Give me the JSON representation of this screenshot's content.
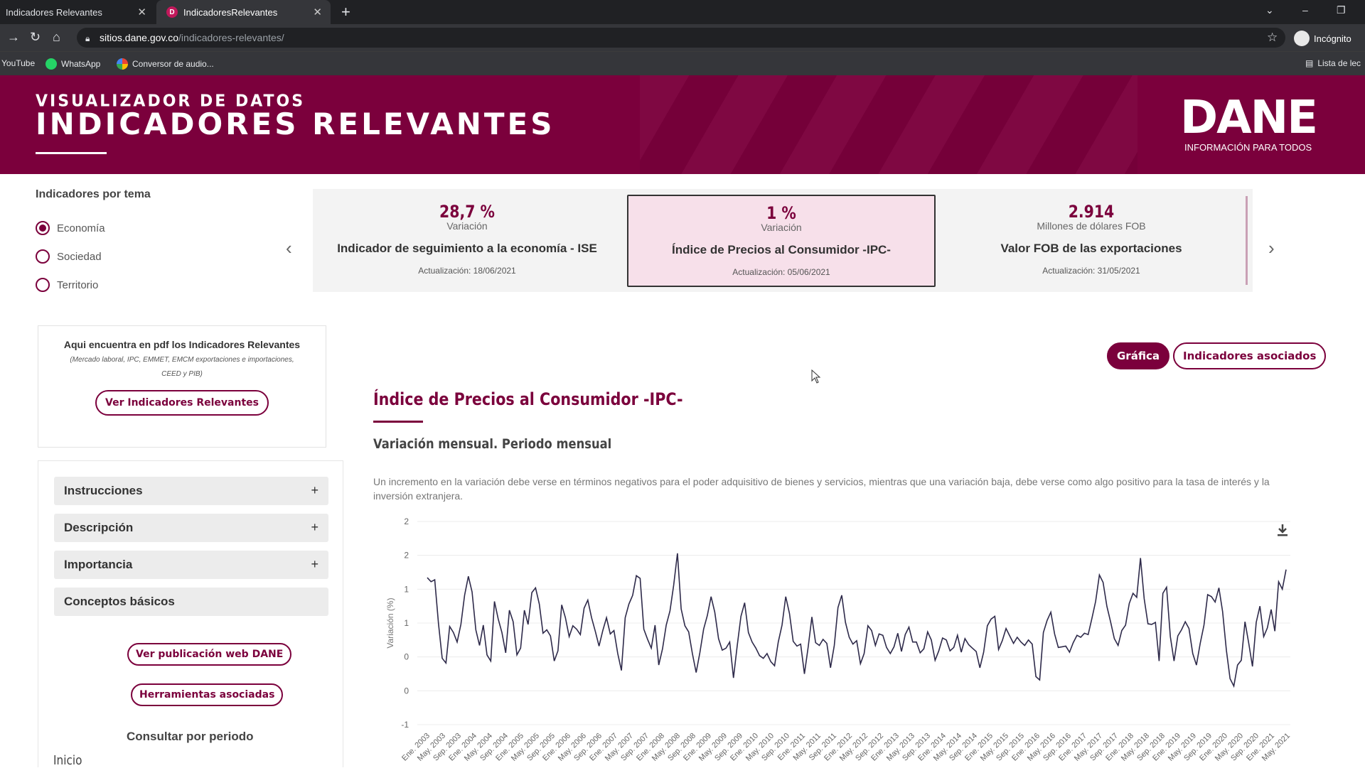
{
  "browser": {
    "tabs": [
      {
        "title": "Indicadores Relevantes",
        "active": false
      },
      {
        "title": "IndicadoresRelevantes",
        "active": true
      }
    ],
    "url_host": "sitios.dane.gov.co",
    "url_path": "/indicadores-relevantes/",
    "profile": "Incógnito",
    "bookmarks": [
      "YouTube",
      "WhatsApp",
      "Conversor de audio..."
    ],
    "reading_list": "Lista de lec"
  },
  "banner": {
    "subtitle": "VISUALIZADOR DE DATOS",
    "title": "INDICADORES RELEVANTES",
    "logo": "DANE",
    "logo_tagline": "INFORMACIÓN PARA TODOS",
    "color": "#7b003c"
  },
  "sidebar": {
    "heading": "Indicadores por tema",
    "themes": [
      {
        "label": "Economía",
        "selected": true
      },
      {
        "label": "Sociedad",
        "selected": false
      },
      {
        "label": "Territorio",
        "selected": false
      }
    ],
    "pdf_box": {
      "title": "Aqui encuentra en pdf los Indicadores Relevantes",
      "subtitle": "(Mercado laboral, IPC, EMMET, EMCM exportaciones e importaciones, CEED y PIB)",
      "button": "Ver Indicadores Relevantes"
    },
    "accordion": [
      {
        "label": "Instrucciones",
        "icon": "+"
      },
      {
        "label": "Descripción",
        "icon": "+"
      },
      {
        "label": "Importancia",
        "icon": "+"
      },
      {
        "label": "Conceptos básicos",
        "icon": ""
      }
    ],
    "btn_publicacion": "Ver publicación web DANE",
    "btn_herramientas": "Herramientas asociadas",
    "consultar": "Consultar por periodo",
    "inicio": "Inicio"
  },
  "cards": [
    {
      "value": "28,7 %",
      "unit": "Variación",
      "name": "Indicador de seguimiento a la economía - ISE",
      "updated": "Actualización: 18/06/2021",
      "selected": false
    },
    {
      "value": "1 %",
      "unit": "Variación",
      "name": "Índice de Precios al Consumidor -IPC-",
      "updated": "Actualización: 05/06/2021",
      "selected": true
    },
    {
      "value": "2.914",
      "unit": "Millones de dólares FOB",
      "name": "Valor FOB de las exportaciones",
      "updated": "Actualización: 31/05/2021",
      "selected": false
    }
  ],
  "main": {
    "btn_grafica": "Gráfica",
    "btn_asociados": "Indicadores asociados",
    "title": "Índice de Precios al Consumidor -IPC-",
    "subtitle": "Variación mensual. Periodo mensual",
    "description": "Un incremento en la variación debe verse en términos negativos para el poder adquisitivo de bienes y servicios, mientras que una variación baja, debe verse como algo positivo para la tasa de interés y la inversión extranjera."
  },
  "chart_data": {
    "type": "line",
    "ylabel": "Variación (%)",
    "ytick_labels": [
      "2",
      "2",
      "1",
      "1",
      "0",
      "0",
      "-1"
    ],
    "ylim": [
      -1,
      2
    ],
    "grid": true,
    "line_color": "#2e2a4a",
    "xtick_labels": [
      "Ene. 2003",
      "May. 2003",
      "Sep. 2003",
      "Ene. 2004",
      "May. 2004",
      "Sep. 2004",
      "Ene. 2005",
      "May. 2005",
      "Sep. 2005",
      "Ene. 2006",
      "May. 2006",
      "Sep. 2006",
      "Ene. 2007",
      "May. 2007",
      "Sep. 2007",
      "Ene. 2008",
      "May. 2008",
      "Sep. 2008",
      "Ene. 2009",
      "May. 2009",
      "Sep. 2009",
      "Ene. 2010",
      "May. 2010",
      "Sep. 2010",
      "Ene. 2011",
      "May. 2011",
      "Sep. 2011",
      "Ene. 2012",
      "May. 2012",
      "Sep. 2012",
      "Ene. 2013",
      "May. 2013",
      "Sep. 2013",
      "Ene. 2014",
      "May. 2014",
      "Sep. 2014",
      "Ene. 2015",
      "May. 2015",
      "Sep. 2015",
      "Ene. 2016",
      "May. 2016",
      "Sep. 2016",
      "Ene. 2017",
      "May. 2017",
      "Sep. 2017",
      "Ene. 2018",
      "May. 2018",
      "Sep. 2018",
      "Ene. 2019",
      "May. 2019",
      "Sep. 2019",
      "Ene. 2020",
      "May. 2020",
      "Sep. 2020",
      "Ene. 2021",
      "May. 2021"
    ],
    "values": [
      1.17,
      1.11,
      1.14,
      0.49,
      -0.02,
      -0.09,
      0.45,
      0.36,
      0.22,
      0.48,
      0.91,
      1.19,
      0.96,
      0.4,
      0.17,
      0.47,
      0.03,
      -0.06,
      0.82,
      0.56,
      0.36,
      0.06,
      0.69,
      0.52,
      0.03,
      0.13,
      0.69,
      0.48,
      0.95,
      1.02,
      0.78,
      0.35,
      0.4,
      0.31,
      -0.06,
      0.09,
      0.77,
      0.58,
      0.3,
      0.46,
      0.41,
      0.33,
      0.72,
      0.84,
      0.58,
      0.38,
      0.16,
      0.39,
      0.58,
      0.34,
      0.39,
      0.05,
      -0.2,
      0.58,
      0.78,
      0.91,
      1.2,
      1.16,
      0.41,
      0.26,
      0.13,
      0.47,
      -0.12,
      0.12,
      0.47,
      0.68,
      1.06,
      1.53,
      0.71,
      0.46,
      0.37,
      0.05,
      -0.23,
      0.06,
      0.41,
      0.61,
      0.89,
      0.66,
      0.27,
      0.1,
      0.13,
      0.22,
      -0.31,
      0.16,
      0.6,
      0.8,
      0.36,
      0.22,
      0.13,
      0.02,
      -0.02,
      0.05,
      -0.07,
      -0.13,
      0.22,
      0.47,
      0.89,
      0.64,
      0.23,
      0.16,
      0.19,
      -0.25,
      0.14,
      0.59,
      0.21,
      0.17,
      0.26,
      0.2,
      -0.16,
      0.17,
      0.73,
      0.91,
      0.51,
      0.29,
      0.19,
      0.24,
      -0.1,
      0.05,
      0.46,
      0.39,
      0.17,
      0.34,
      0.32,
      0.14,
      0.05,
      0.15,
      0.35,
      0.08,
      0.33,
      0.44,
      0.22,
      0.22,
      0.06,
      0.12,
      0.37,
      0.25,
      -0.05,
      0.09,
      0.28,
      0.25,
      0.09,
      0.14,
      0.32,
      0.07,
      0.27,
      0.18,
      0.13,
      0.08,
      -0.16,
      0.07,
      0.46,
      0.56,
      0.6,
      0.11,
      0.24,
      0.42,
      0.31,
      0.2,
      0.29,
      0.22,
      0.17,
      0.25,
      0.19,
      -0.29,
      -0.34,
      0.36,
      0.54,
      0.66,
      0.34,
      0.14,
      0.15,
      0.16,
      0.07,
      0.21,
      0.32,
      0.29,
      0.35,
      0.33,
      0.57,
      0.82,
      1.21,
      1.1,
      0.75,
      0.52,
      0.27,
      0.17,
      0.39,
      0.47,
      0.79,
      0.94,
      0.88,
      1.46,
      0.86,
      0.49,
      0.48,
      0.51,
      -0.06,
      0.94,
      1.03,
      0.3,
      -0.06,
      0.31,
      0.4,
      0.52,
      0.42,
      0.05,
      -0.12,
      0.2,
      0.47,
      0.92,
      0.89,
      0.81,
      1.02,
      0.67,
      0.1,
      -0.32,
      -0.43,
      -0.12,
      -0.05,
      0.52,
      0.2,
      -0.14,
      0.51,
      0.75,
      0.3,
      0.43,
      0.7,
      0.38,
      1.11,
      1.0,
      1.29
    ]
  }
}
